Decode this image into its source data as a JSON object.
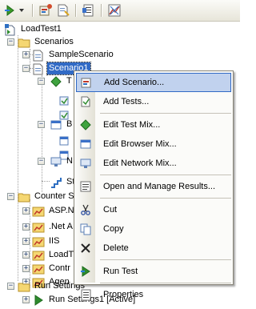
{
  "toolbar": {
    "buttons": [
      "add-dropdown-icon",
      "scenario-icon",
      "new-test-icon",
      "properties-icon",
      "counter-icon"
    ]
  },
  "tree": {
    "root": "LoadTest1",
    "scenarios_folder": "Scenarios",
    "sample_scenario": "SampleScenario",
    "scenario1": "Scenario1",
    "partial_children": [
      "T",
      "B",
      "N",
      "St"
    ],
    "counter_sets_folder": "Counter S",
    "counter_items": [
      "ASP.N",
      ".Net A",
      "IIS",
      "LoadT",
      "Contr",
      "Agen"
    ],
    "run_settings_folder": "Run Settings",
    "run_settings_item": "Run Settings1 [Active]"
  },
  "context_menu": {
    "add_scenario": "Add Scenario...",
    "add_tests": "Add Tests...",
    "edit_test_mix": "Edit Test Mix...",
    "edit_browser_mix": "Edit Browser Mix...",
    "edit_network_mix": "Edit Network Mix...",
    "open_manage_results": "Open and Manage Results...",
    "cut": "Cut",
    "copy": "Copy",
    "delete": "Delete",
    "run_test": "Run Test",
    "properties": "Properties"
  },
  "colors": {
    "selection": "#316ac5",
    "menu_hot": "#c1d2ee"
  }
}
